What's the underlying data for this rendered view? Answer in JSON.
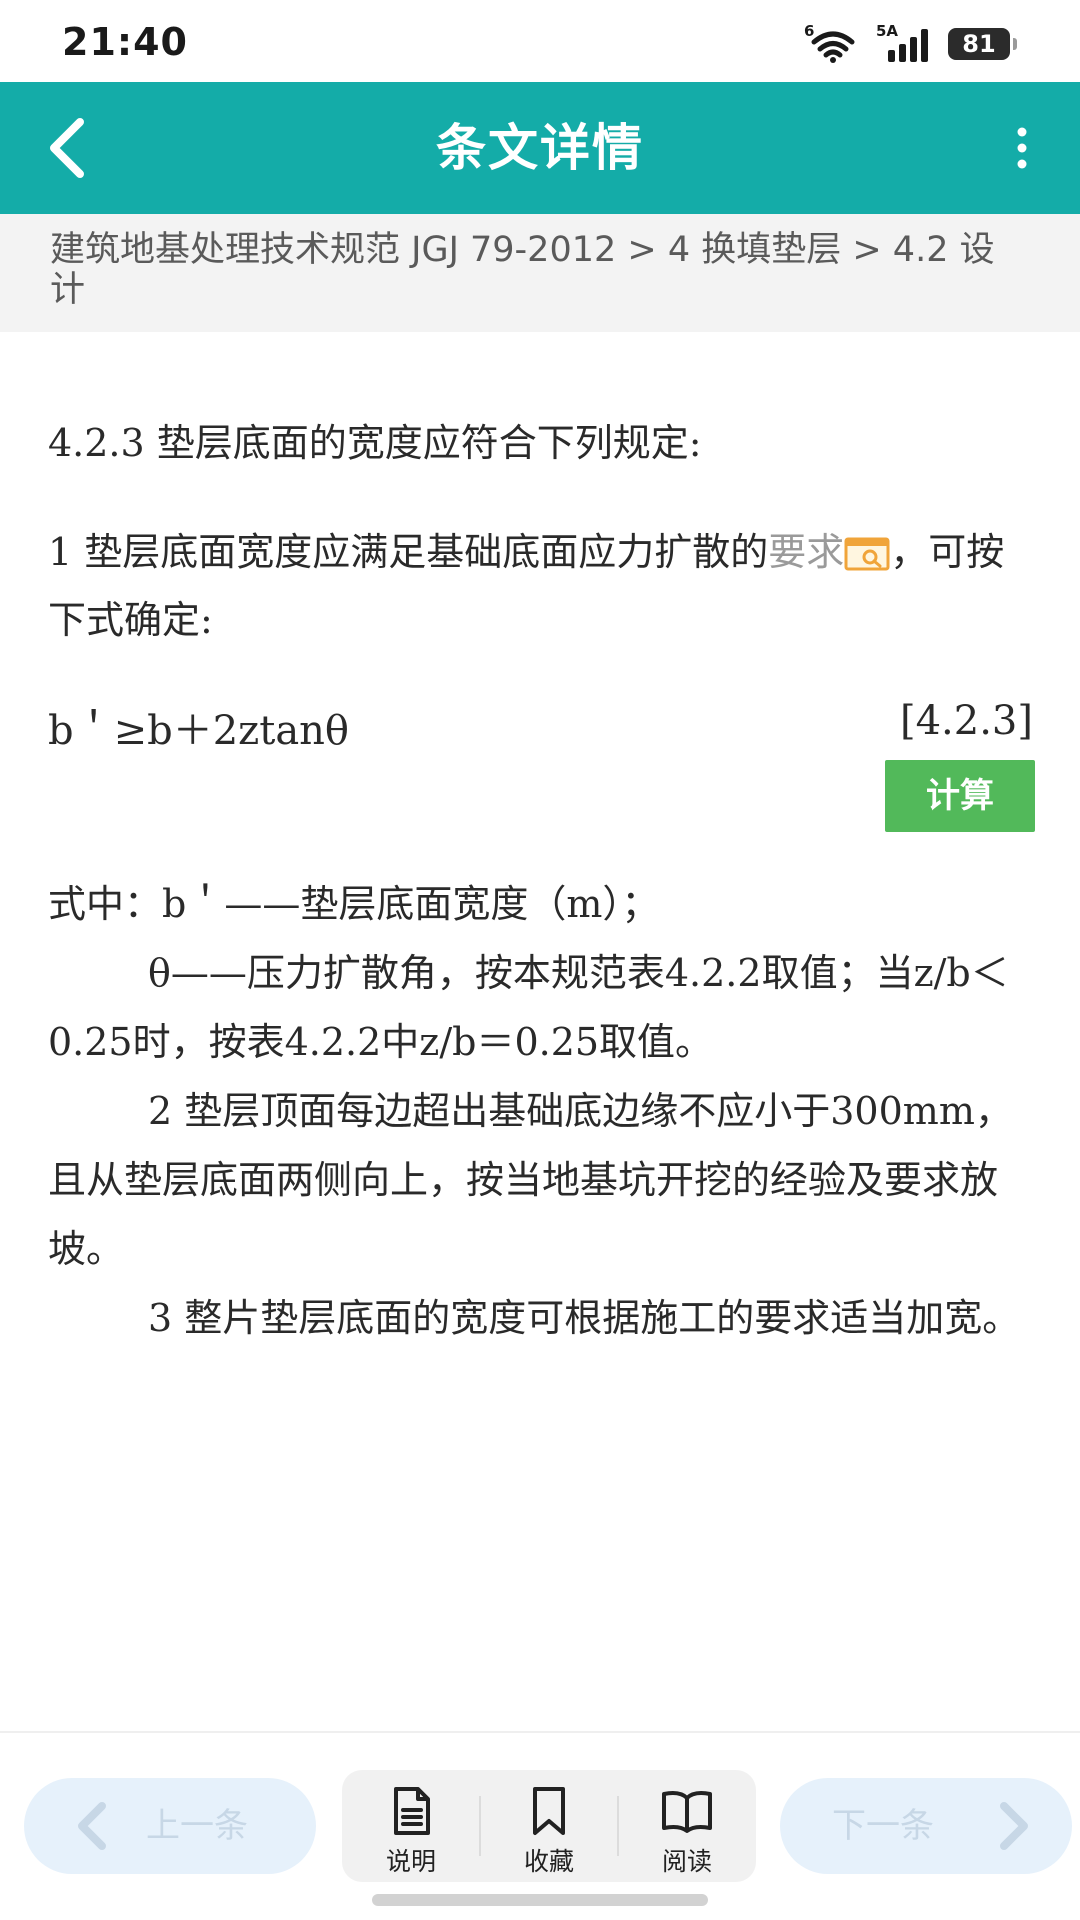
{
  "status_bar": {
    "time": "21:40",
    "network_1": "6",
    "network_2": "5A",
    "battery": "81"
  },
  "app_bar": {
    "title": "条文详情",
    "back_icon": "chevron-left-icon",
    "more_icon": "more-vert-icon"
  },
  "breadcrumb": {
    "text": "建筑地基处理技术规范 JGJ 79-2012 > 4 换填垫层 > 4.2 设 计"
  },
  "content": {
    "clause_heading": "4.2.3 垫层底面的宽度应符合下列规定:",
    "para1_prefix": "1 垫层底面宽度应满足基础底面应力扩散的",
    "para1_link": "要求",
    "para1_suffix": "，可按下式确定:",
    "formula": "b＇≥b＋2ztanθ",
    "formula_number": "[4.2.3]",
    "calc_button": "计算",
    "where_line1": "式中：b＇——垫层底面宽度（m）；",
    "where_line2": "θ——压力扩散角，按本规范表4.2.2取值；当z/b＜0.25时，按表4.2.2中z/b＝0.25取值。",
    "item2": "2 垫层顶面每边超出基础底边缘不应小于300mm，且从垫层底面两侧向上，按当地基坑开挖的经验及要求放坡。",
    "item3": "3 整片垫层底面的宽度可根据施工的要求适当加宽。"
  },
  "bottom_bar": {
    "prev_label": "上一条",
    "next_label": "下一条",
    "tools": [
      {
        "label": "说明",
        "icon": "document-icon"
      },
      {
        "label": "收藏",
        "icon": "bookmark-icon"
      },
      {
        "label": "阅读",
        "icon": "open-book-icon"
      }
    ]
  },
  "colors": {
    "accent": "#14aca8",
    "calc_button": "#52b95a",
    "breadcrumb_bg": "#f3f3f3",
    "nav_pill_bg": "#e6f1fb"
  }
}
